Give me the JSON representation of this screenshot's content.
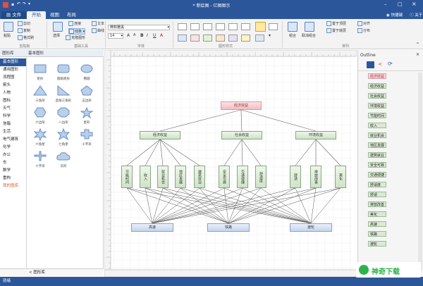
{
  "app": {
    "title": "* 新绘图 - 亿图图示",
    "file_tab": "文件",
    "tabs": [
      "开始",
      "视图",
      "布局"
    ],
    "login": "快捷键",
    "about": "关于"
  },
  "ribbon": {
    "paste": "粘贴",
    "cut": "剪切",
    "copy": "复制",
    "format_painter": "格式刷",
    "clipboard_label": "剪贴板",
    "select": "选择",
    "clone_shape": "克隆图形",
    "connector": "连接",
    "text": "文本",
    "line": "线条",
    "curve": "曲线",
    "tools_label": "基础工具",
    "font_name": "微软雅黑",
    "font_size": "14",
    "font_label": "字体",
    "styles_label": "图形样式",
    "group": "组合",
    "ungroup": "取消组合",
    "bring_front": "置于顶层",
    "send_back": "置于底层",
    "align": "对齐",
    "distribute": "分布",
    "arrange_label": "排列"
  },
  "left_panel": {
    "header_library": "图形库",
    "header_basic": "基本图形",
    "categories": [
      "基本图形",
      "通用图形",
      "流程图",
      "箭头",
      "人物",
      "图标",
      "天气",
      "科学",
      "信箱",
      "生活",
      "电气建筑",
      "化学",
      "办公",
      "车",
      "数学",
      "重构",
      "我的图库"
    ],
    "shapes": [
      "矩形",
      "圆角矩形",
      "椭圆",
      "三角形",
      "直角三角形",
      "五边形",
      "六边形",
      "八边形",
      "星形",
      "六角星",
      "七角星",
      "十字形",
      "十字形",
      "云形"
    ],
    "footer_library": "图形库"
  },
  "diagram": {
    "root": "经济效益",
    "level1": [
      "经济收益",
      "社会收益",
      "环境收益"
    ],
    "level2": [
      "节能时间",
      "收入",
      "就业机会",
      "地区发展",
      "建筑就业",
      "安全可靠",
      "交通便捷",
      "舒适度",
      "舒适",
      "排放改善",
      "美化"
    ],
    "level3": [
      "高速",
      "铁路",
      "渡轮"
    ]
  },
  "outline": {
    "title": "Outline",
    "items": [
      "经济效益",
      "经济收益",
      "社会收益",
      "环境收益",
      "节能时间",
      "收入",
      "就业机会",
      "地区发展",
      "建筑就业",
      "安全可靠",
      "交通便捷",
      "舒适度",
      "舒适",
      "排放改善",
      "美化",
      "高速",
      "铁路",
      "渡轮"
    ]
  },
  "status": {
    "text": "就绪",
    "watermark": "神奇下载"
  },
  "colors": {
    "brand": "#2b579a",
    "root_fill": "#f2bcc3",
    "node_fill": "#cfe3c7",
    "bottom_fill": "#c6d4ec"
  }
}
